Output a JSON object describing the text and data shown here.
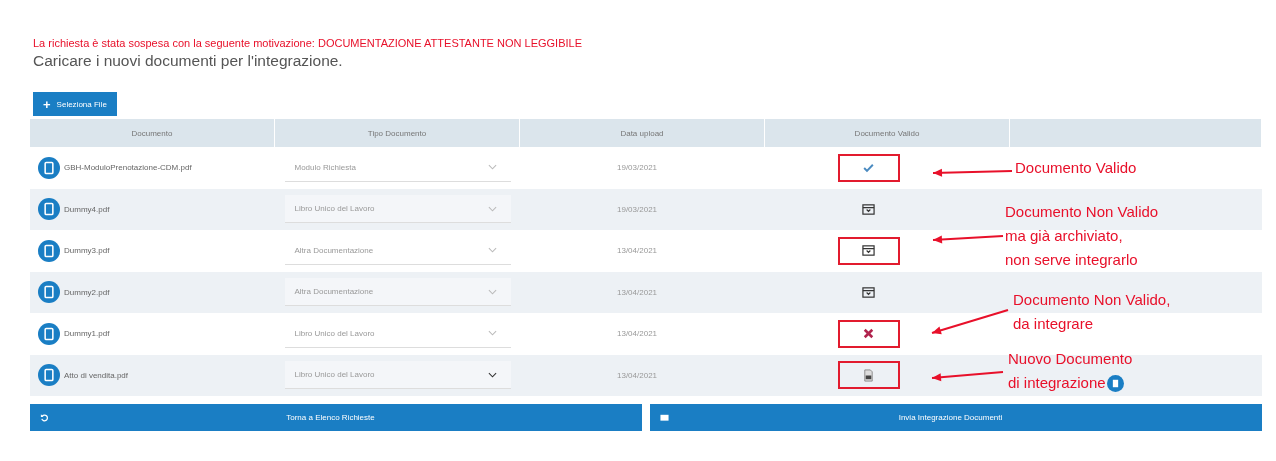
{
  "notice": {
    "reason_label": "La richiesta è stata sospesa con la seguente motivazione:",
    "reason": "DOCUMENTAZIONE ATTESTANTE NON LEGGIBILE",
    "instruction": "Caricare i nuovi documenti per l'integrazione."
  },
  "select_button": {
    "icon": "+",
    "label": "Seleziona File"
  },
  "table": {
    "columns": [
      "Documento",
      "Tipo Documento",
      "Data upload",
      "Documento Valido"
    ],
    "rows": [
      {
        "file": "GBH-ModuloPrenotazione-CDM.pdf",
        "type": "Modulo Richiesta",
        "disabled": true,
        "date": "19/03/2021",
        "kind": "valid",
        "highlighted": true
      },
      {
        "file": "Dummy4.pdf",
        "type": "Libro Unico del Lavoro",
        "disabled": true,
        "date": "19/03/2021",
        "kind": "archived",
        "highlighted": false
      },
      {
        "file": "Dummy3.pdf",
        "type": "Altra Documentazione",
        "disabled": true,
        "date": "13/04/2021",
        "kind": "archived",
        "highlighted": true
      },
      {
        "file": "Dummy2.pdf",
        "type": "Altra Documentazione",
        "disabled": true,
        "date": "13/04/2021",
        "kind": "archived",
        "highlighted": false
      },
      {
        "file": "Dummy1.pdf",
        "type": "Libro Unico del Lavoro",
        "disabled": true,
        "date": "13/04/2021",
        "kind": "invalid",
        "highlighted": true
      },
      {
        "file": "Atto di vendita.pdf",
        "type": "Libro Unico del Lavoro",
        "disabled": false,
        "date": "13/04/2021",
        "kind": "new",
        "highlighted": true
      }
    ]
  },
  "annotations": [
    {
      "lines": [
        "Documento Valido"
      ]
    },
    {
      "lines": [
        "Documento Non Valido",
        "ma già archiviato,",
        "non serve integrarlo"
      ]
    },
    {
      "lines": [
        "Documento Non Valido,",
        "da integrare"
      ]
    },
    {
      "lines": [
        "Nuovo Documento",
        "di integrazione"
      ],
      "badge": true
    }
  ],
  "actions": [
    {
      "kind": "back",
      "label": "Torna a Elenco Richieste"
    },
    {
      "kind": "send",
      "label": "Invia Integrazione Documenti"
    }
  ]
}
